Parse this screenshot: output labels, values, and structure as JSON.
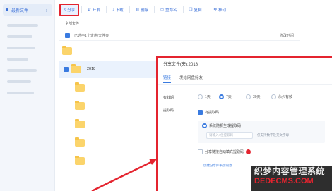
{
  "sidebar": {
    "active_label": "最新文件"
  },
  "toolbar": {
    "share_label": "分享",
    "open_label": "开发",
    "download_label": "下载",
    "delete_label": "删除",
    "rename_label": "重命名",
    "copy_label": "复制",
    "move_label": "移动"
  },
  "breadcrumb": "全部文件",
  "list_header": {
    "selected_text": "已选中1个文件/文件夹",
    "modified_col": "修改时间"
  },
  "files": [
    {
      "name": "2018",
      "selected": true
    }
  ],
  "dialog": {
    "title": "分享文件(夹):2018",
    "tabs": [
      "链接",
      "发给网盘好友"
    ],
    "validity_label": "有效期:",
    "validity_options": [
      "1天",
      "7天",
      "30天",
      "永久有效"
    ],
    "validity_selected": "7天",
    "code_label": "提取码:",
    "code_checkbox": "有提取码",
    "auto_code": "系统随机生成提取码",
    "custom_placeholder": "请输入4位提取码",
    "custom_hint": "仅支持数字及英文字母",
    "auto_fill": "分享链接自动填充提取码",
    "footer_note": "创建分享即表示同意..."
  },
  "watermark": {
    "line1": "织梦内容管理系统",
    "line2": "DEDECMS.COM"
  },
  "colors": {
    "accent": "#3a7be0",
    "highlight_red": "#e4242f",
    "folder": "#fbd46b"
  }
}
